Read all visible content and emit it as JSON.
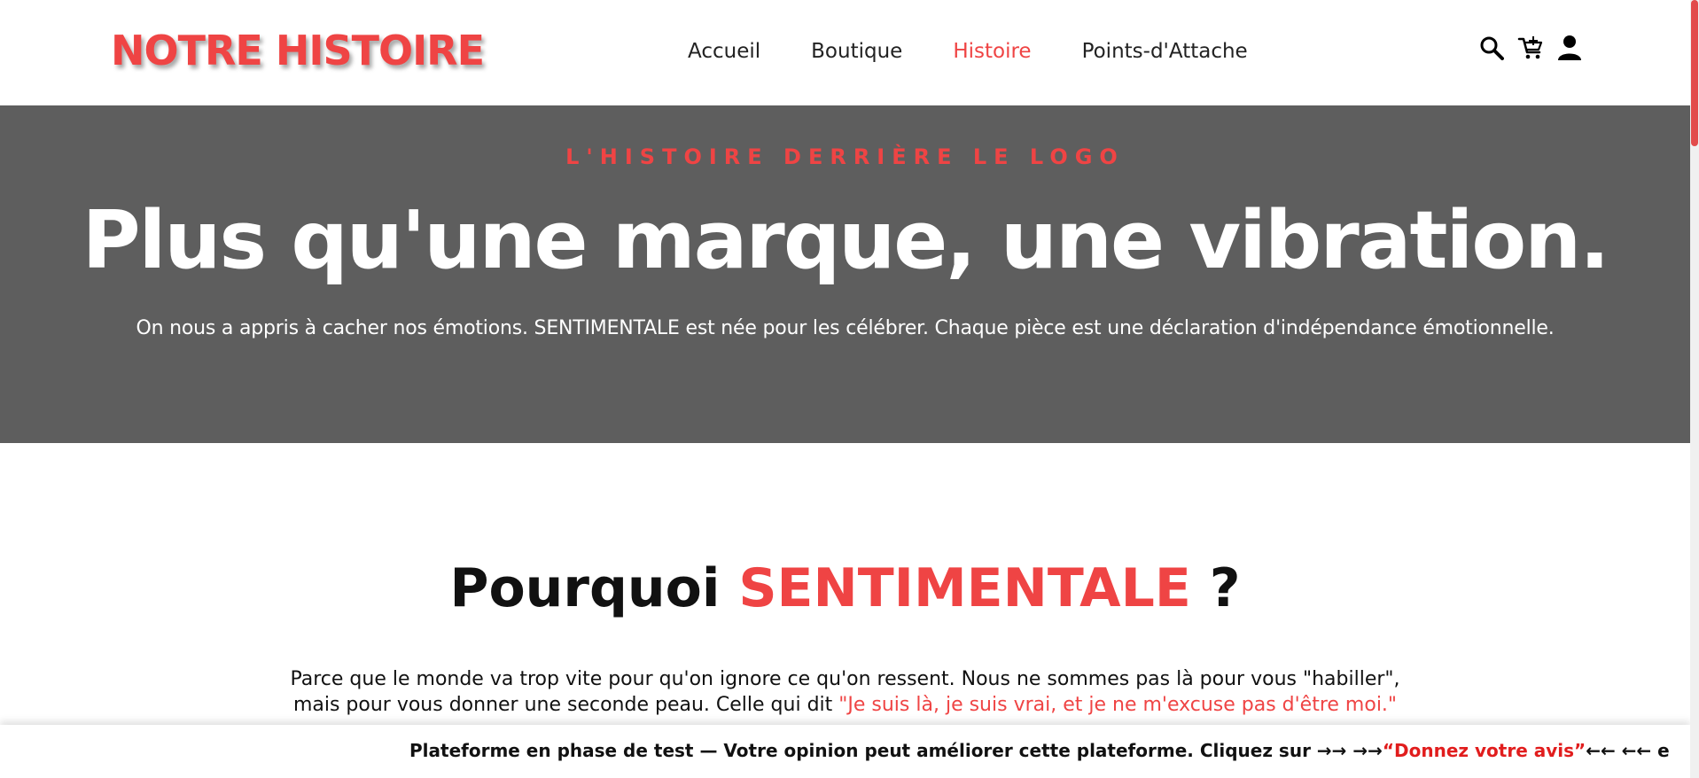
{
  "header": {
    "logo": "NOTRE HISTOIRE",
    "nav": [
      {
        "label": "Accueil",
        "active": false
      },
      {
        "label": "Boutique",
        "active": false
      },
      {
        "label": "Histoire",
        "active": true
      },
      {
        "label": "Points-d'Attache",
        "active": false
      }
    ],
    "icons": [
      "search-icon",
      "cart-icon",
      "user-icon"
    ]
  },
  "hero": {
    "eyebrow": "L'HISTOIRE DERRIÈRE LE LOGO",
    "title": "Plus qu'une marque, une vibration.",
    "text": "On nous a appris à cacher nos émotions. SENTIMENTALE est née pour les célébrer. Chaque pièce est une déclaration d'indépendance émotionnelle."
  },
  "why": {
    "title_prefix": "Pourquoi ",
    "title_accent": "SENTIMENTALE",
    "title_suffix": " ?",
    "text_line1": "Parce que le monde va trop vite pour qu'on ignore ce qu'on ressent. Nous ne sommes pas là pour vous \"habiller\",",
    "text_line2": "mais pour vous donner une seconde peau. Celle qui dit ",
    "quote": "\"Je suis là, je suis vrai, et je ne m'excuse pas d'être moi.\""
  },
  "feedback": {
    "text": "Plateforme en phase de test — Votre opinion peut améliorer cette plateforme. Cliquez sur →→  →→",
    "link": "“Donnez votre avis”",
    "tail": "←←  ←← e"
  },
  "colors": {
    "accent": "#ef4444",
    "hero_bg": "#5e5e5e",
    "text": "#111111"
  }
}
